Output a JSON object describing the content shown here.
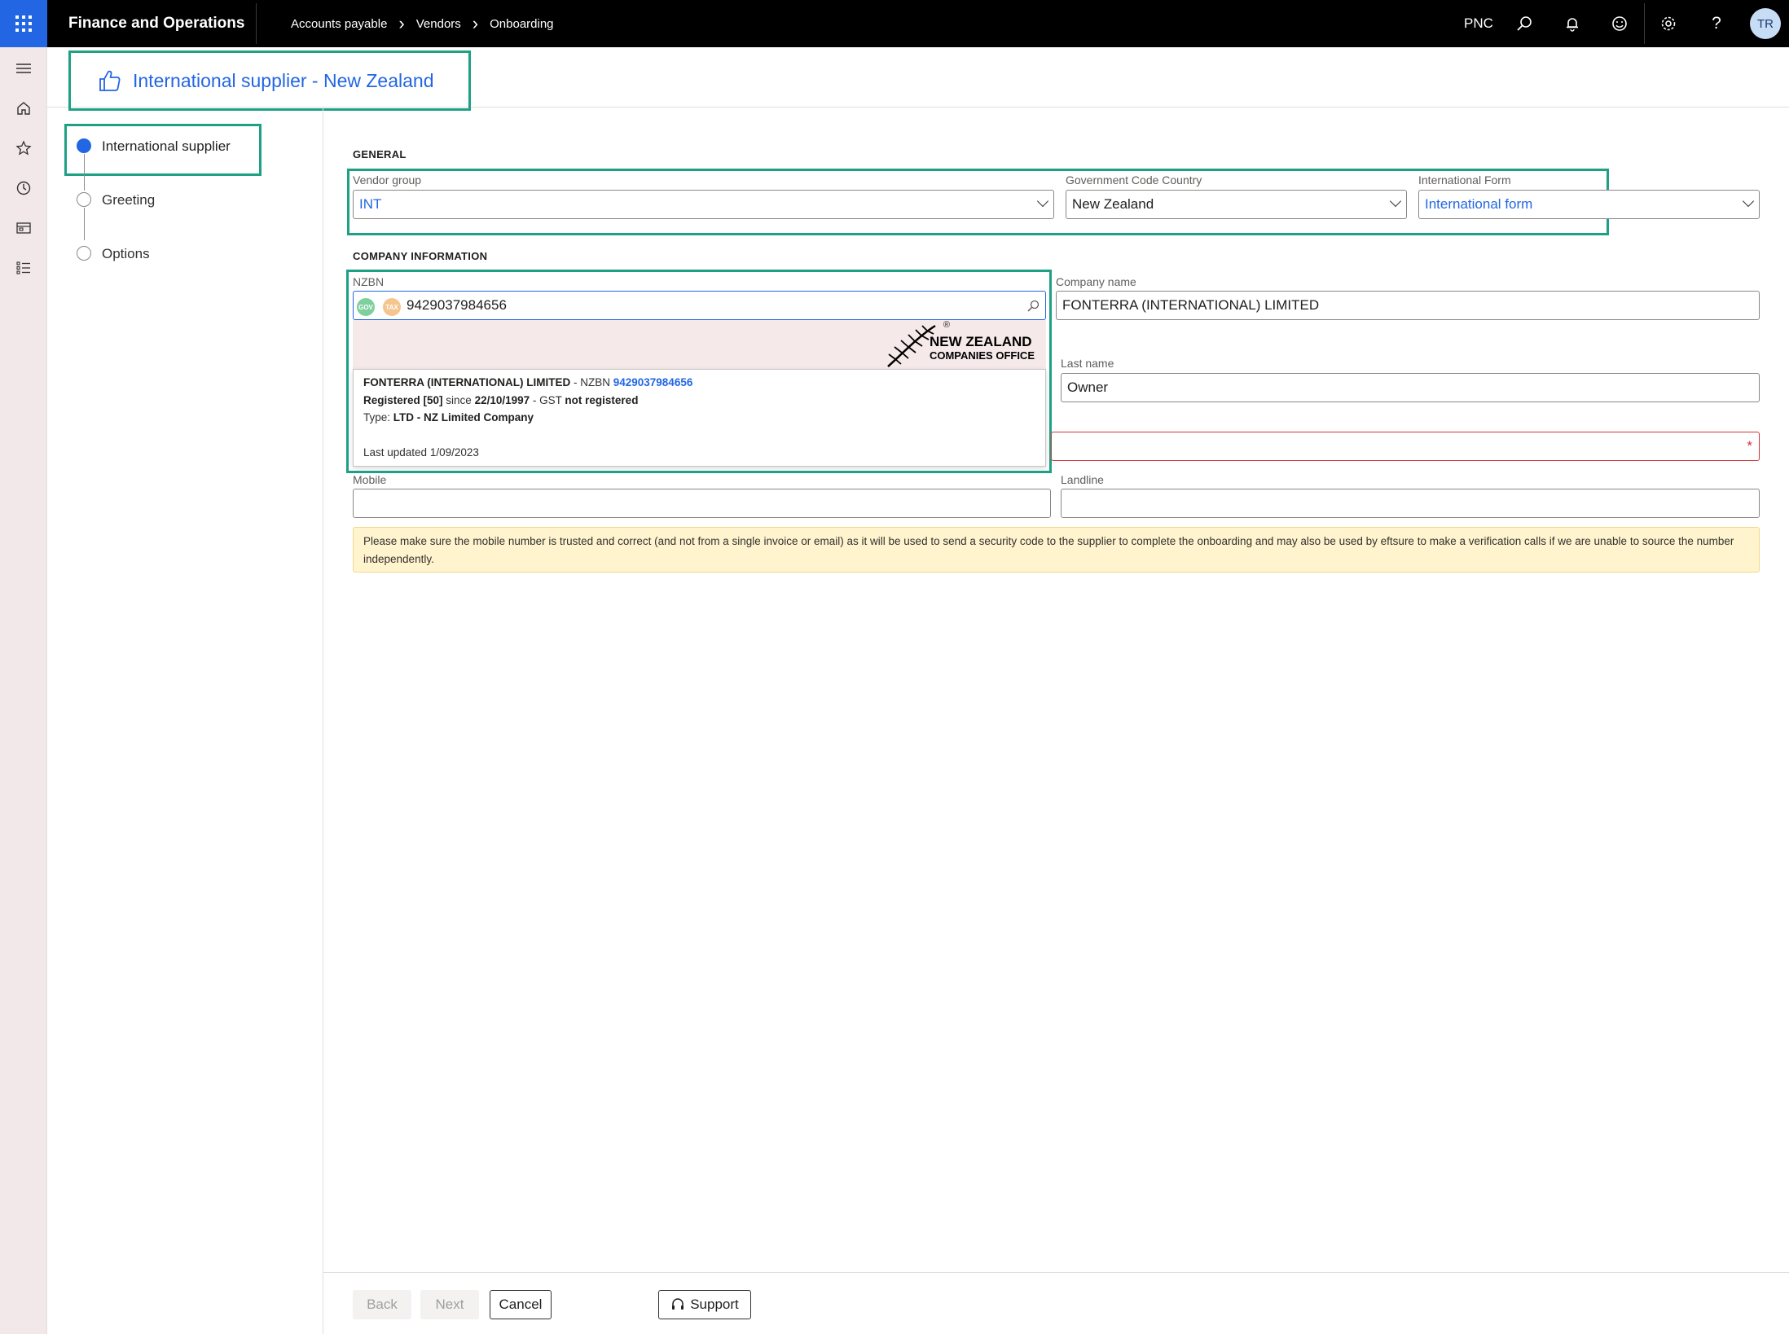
{
  "topbar": {
    "app_title": "Finance and Operations",
    "breadcrumbs": [
      "Accounts payable",
      "Vendors",
      "Onboarding"
    ],
    "company": "PNC",
    "user_initials": "TR"
  },
  "page": {
    "title": "International supplier - New Zealand"
  },
  "steps": [
    {
      "label": "International supplier",
      "active": true
    },
    {
      "label": "Greeting",
      "active": false
    },
    {
      "label": "Options",
      "active": false
    }
  ],
  "general": {
    "section_title": "GENERAL",
    "vendor_group": {
      "label": "Vendor group",
      "value": "INT"
    },
    "gov_country": {
      "label": "Government Code Country",
      "value": "New Zealand"
    },
    "intl_form": {
      "label": "International Form",
      "value": "International form"
    }
  },
  "company_info": {
    "section_title": "COMPANY INFORMATION",
    "nzbn": {
      "label": "NZBN",
      "value": "9429037984656",
      "chip1": "GOV",
      "chip2": "TAX"
    },
    "company_name": {
      "label": "Company name",
      "value": "FONTERRA (INTERNATIONAL) LIMITED"
    },
    "last_name": {
      "label": "Last name",
      "value": "Owner"
    },
    "required_marker": "*",
    "mobile": {
      "label": "Mobile",
      "value": ""
    },
    "landline": {
      "label": "Landline",
      "value": ""
    }
  },
  "lookup": {
    "logo_line1": "NEW ZEALAND",
    "logo_line2": "COMPANIES OFFICE",
    "logo_reg": "®",
    "company": "FONTERRA (INTERNATIONAL) LIMITED",
    "nzbn_prefix": " - NZBN ",
    "nzbn": "9429037984656",
    "status": "Registered [50]",
    "since_word": " since ",
    "since_date": "22/10/1997",
    "gst_prefix": " - GST ",
    "gst_status": "not registered",
    "type_prefix": "Type: ",
    "type": "LTD - NZ Limited Company",
    "updated": "Last updated 1/09/2023"
  },
  "notice": "Please make sure the mobile number is trusted and correct (and not from a single invoice or email) as it will be used to send a security code to the supplier to complete the onboarding and may also be used by eftsure to make a verification calls if we are unable to source the number independently.",
  "footer": {
    "back": "Back",
    "next": "Next",
    "cancel": "Cancel",
    "support": "Support"
  },
  "colors": {
    "accent": "#2266e3",
    "highlight": "#1ea085",
    "error": "#d13438",
    "notice_bg": "#fff4ce"
  }
}
